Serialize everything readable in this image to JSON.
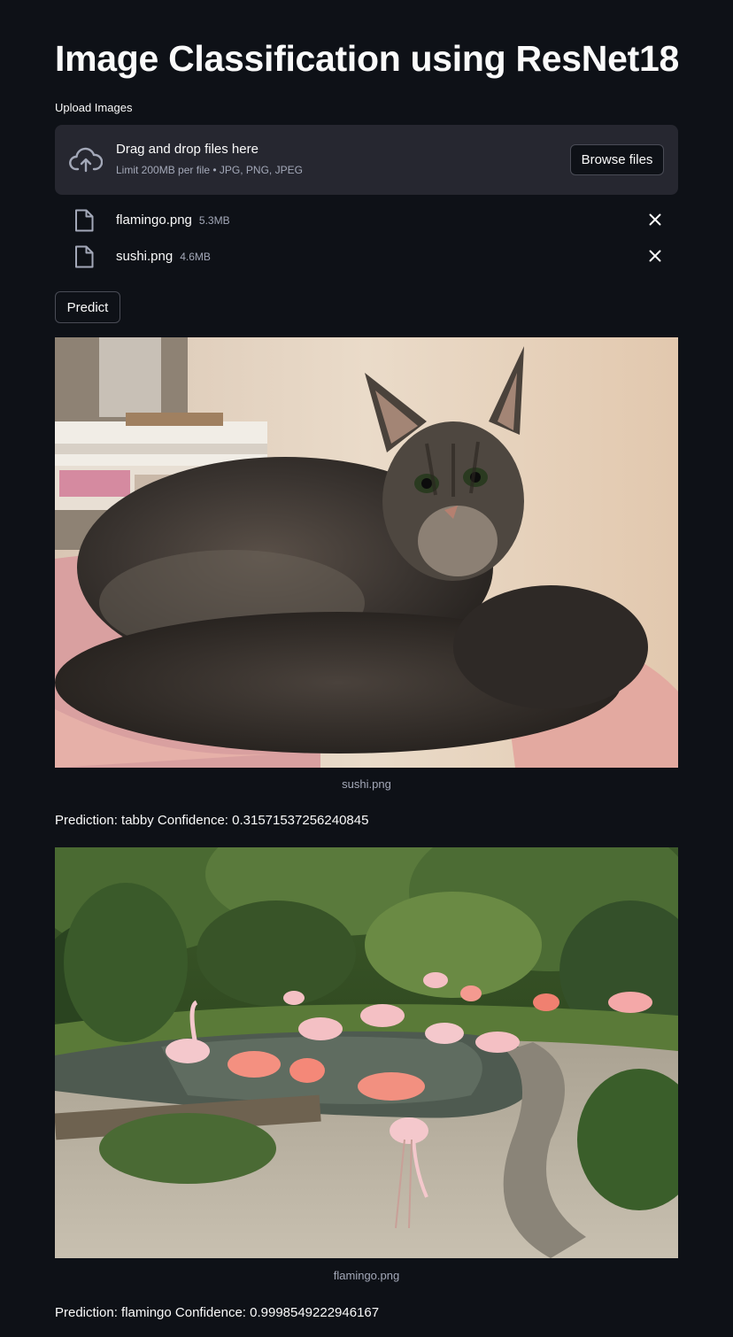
{
  "page": {
    "title": "Image Classification using ResNet18"
  },
  "uploader": {
    "label": "Upload Images",
    "drop_text": "Drag and drop files here",
    "limit_text": "Limit 200MB per file • JPG, PNG, JPEG",
    "browse_label": "Browse files",
    "icon": "cloud-upload-icon"
  },
  "files": [
    {
      "name": "flamingo.png",
      "size": "5.3MB"
    },
    {
      "name": "sushi.png",
      "size": "4.6MB"
    }
  ],
  "predict_label": "Predict",
  "results": [
    {
      "caption": "sushi.png",
      "prediction": "Prediction: tabby Confidence: 0.31571537256240845"
    },
    {
      "caption": "flamingo.png",
      "prediction": "Prediction: flamingo Confidence: 0.9998549222946167"
    }
  ],
  "colors": {
    "background": "#0e1117",
    "dropzone": "#262730",
    "text": "#fafafa",
    "muted_text": "#a3a8b8",
    "border": "#4a4c56"
  }
}
